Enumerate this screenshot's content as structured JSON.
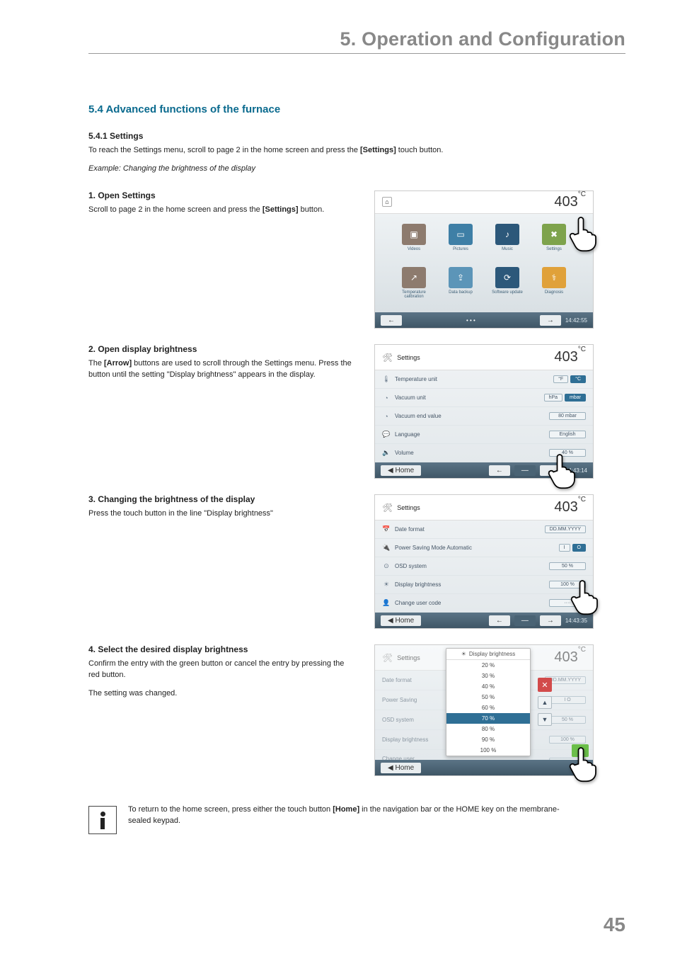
{
  "chapter": "5. Operation and Configuration",
  "h2": "5.4   Advanced functions of the furnace",
  "s541_title": "5.4.1  Settings",
  "s541_intro_a": "To reach the Settings menu, scroll to page 2 in the home screen and press the ",
  "s541_intro_b": "[Settings]",
  "s541_intro_c": " touch button.",
  "s541_example": "Example: Changing the brightness of the display",
  "step1_title": "1. Open Settings",
  "step1_body_a": "Scroll to page 2 in the home screen and press the ",
  "step1_body_b": "[Settings]",
  "step1_body_c": " button.",
  "step2_title": "2. Open display brightness",
  "step2_body_a": "The ",
  "step2_body_b": "[Arrow]",
  "step2_body_c": " buttons are used to scroll through the Settings menu. Press the button until the setting \"Display brightness\" appears in the display.",
  "step3_title": "3. Changing the brightness of the display",
  "step3_body": "Press the touch button in the line \"Display brightness\"",
  "step4_title": "4. Select the desired display brightness",
  "step4_body_a": "Confirm the entry with the green button or cancel the entry by pressing the red button.",
  "step4_body_b": "The setting was changed.",
  "info_a": "To return to the home screen, press either the touch button ",
  "info_b": "[Home]",
  "info_c": " in the navigation bar or the HOME key on the membrane-sealed keypad.",
  "pagenum": "45",
  "shot_common": {
    "temp_value": "403",
    "temp_unit": "°C"
  },
  "shot1": {
    "clock": "14:42:55",
    "tiles": [
      {
        "lab": "Videos",
        "cls": "gray",
        "glyph": "▣"
      },
      {
        "lab": "Pictures",
        "cls": "blue",
        "glyph": "▭"
      },
      {
        "lab": "Music",
        "cls": "dblue",
        "glyph": "♪"
      },
      {
        "lab": "Settings",
        "cls": "green",
        "glyph": "✖"
      },
      {
        "lab": "Temperature calibration",
        "cls": "gray",
        "glyph": "↗"
      },
      {
        "lab": "Data backup",
        "cls": "lblue",
        "glyph": "⇪"
      },
      {
        "lab": "Software update",
        "cls": "dblue",
        "glyph": "⟳"
      },
      {
        "lab": "Diagnosis",
        "cls": "orange",
        "glyph": "⚕"
      }
    ],
    "page_ind": "• • •"
  },
  "shot2": {
    "title": "Settings",
    "clock": "14:43:14",
    "rows": [
      {
        "icon": "🌡",
        "label": "Temperature unit",
        "vals": [
          "°F",
          "°C"
        ],
        "sel": 1
      },
      {
        "icon": "◔",
        "label": "Vacuum unit",
        "vals": [
          "hPa",
          "mbar"
        ],
        "sel": 1
      },
      {
        "icon": "◔",
        "label": "Vacuum end value",
        "vals": [
          "80 mbar"
        ]
      },
      {
        "icon": "💬",
        "label": "Language",
        "vals": [
          "English"
        ]
      },
      {
        "icon": "🔈",
        "label": "Volume",
        "vals": [
          "40 %"
        ]
      }
    ],
    "home": "Home"
  },
  "shot3": {
    "title": "Settings",
    "clock": "14:43:35",
    "rows": [
      {
        "icon": "📅",
        "label": "Date format",
        "vals": [
          "DD.MM.YYYY"
        ]
      },
      {
        "icon": "🔌",
        "label": "Power Saving Mode Automatic",
        "vals": [
          "I",
          "O"
        ],
        "sel": 1
      },
      {
        "icon": "⊙",
        "label": "OSD system",
        "vals": [
          "50 %"
        ]
      },
      {
        "icon": "☀",
        "label": "Display brightness",
        "vals": [
          "100 %"
        ]
      },
      {
        "icon": "👤",
        "label": "Change user code",
        "vals": [
          "····"
        ]
      }
    ],
    "home": "Home"
  },
  "shot4": {
    "title_bg": "Settings",
    "clock": "",
    "popup_title": "Display brightness",
    "options": [
      "20 %",
      "30 %",
      "40 %",
      "50 %",
      "60 %",
      "70 %",
      "80 %",
      "90 %",
      "100 %"
    ],
    "selected": "70 %",
    "bg_rows": [
      {
        "label": "Date format",
        "val": "DD.MM.YYYY"
      },
      {
        "label": "Power Saving",
        "val": "I  O"
      },
      {
        "label": "OSD system",
        "val": "50 %"
      },
      {
        "label": "Display brightness",
        "val": "100 %"
      },
      {
        "label": "Change user",
        "val": ""
      }
    ],
    "home": "Home"
  }
}
